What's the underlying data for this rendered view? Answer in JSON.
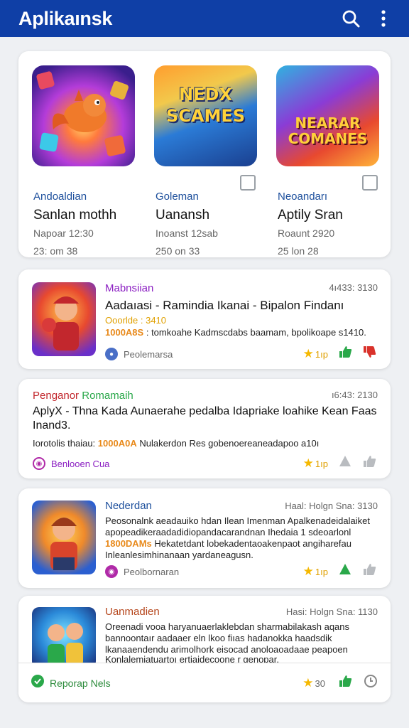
{
  "app": {
    "title": "Aplikaınsk"
  },
  "featured": [
    {
      "category": "Andoaldian",
      "name": "Sanlan mothh",
      "meta1": "Napoar 12:30",
      "meta2": "23: om 38",
      "art_text": ""
    },
    {
      "category": "Goleman",
      "name": "Uanansh",
      "meta1": "Inoanst 12sab",
      "meta2": "250 on 33",
      "art_text": "NEDX SCAMES"
    },
    {
      "category": "Neoandarı",
      "name": "Aptily Sran",
      "meta1": "Roaunt 2920",
      "meta2": "25 lon 28",
      "art_text": "NEARAR COMANES"
    }
  ],
  "cards": [
    {
      "source": "Mabnsiian",
      "source_color": "#8b1fc2",
      "time": "4ı433: 3130",
      "headline": "Aadaıasi - Ramindia Ikanai - Bipalon Findanı",
      "sub": "Ooorlde : 3410",
      "highlight": "1000A8S",
      "body": ": tomkoahe Kadmscdabs baamam, bpolikoape s1410.",
      "author": "Peolemarsa",
      "rating": "1ıp"
    },
    {
      "source": "Penganor",
      "source2": "Romamaih",
      "time": "ı6:43: 2130",
      "headline": "AplyX - Thna Kada Aunaerahe pedalba Idapriake loahike Kean Faas",
      "headline2": "Inand3.",
      "highlight": "1000A0A",
      "body_pre": "Iorotolis thaiau:",
      "body": "Nulakerdon Res gobenoereaneadapoo a10ı",
      "author": "Benlooen Cua",
      "rating": "1ıp"
    },
    {
      "source": "Nederdan",
      "source_color": "#1d4f9c",
      "time": "Haal: Holgn Sna: 3130",
      "highlight": "1800DAMs",
      "body_lines": [
        "Peosonalnk aeadauiko hdan Ilean Imenman Apalkenadeidalaiket",
        "apopeadikeraadadidiopandacarandnan Ihedaia 1 sdeoarlonl",
        "Hekatetdant lobekadentaoakenpaot angiharefau",
        "Inleanlesimhinanaan yardaneagusn."
      ],
      "author": "Peolbornaran",
      "rating": "1ıp"
    },
    {
      "source": "Uanmadien",
      "source_color": "#b5451b",
      "time": "Hasi: Holgn Sna: 1130",
      "body_lines": [
        "Oreenadi vooa haryanuaerlaklebdan sharmabilakash aqans",
        "bannoontaır aadaaer eln lkoo fiıas hadanokka haadsdik",
        "lkanaaendendu arimolhork eisocad anoloaoadaae peapoen",
        "Konlalemiatuartoı ertiaidecoone r genopar."
      ]
    }
  ],
  "bottom_bar": {
    "label": "Reporap Nels",
    "rating": "30"
  }
}
